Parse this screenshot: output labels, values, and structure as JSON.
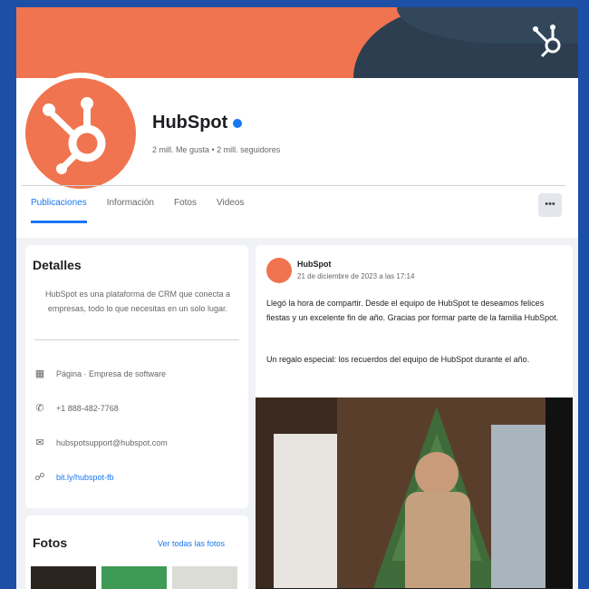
{
  "page": {
    "name": "HubSpot",
    "subtitle": "2 mill. Me gusta • 2 mill. seguidores"
  },
  "tabs": [
    {
      "label": "Publicaciones"
    },
    {
      "label": "Información"
    },
    {
      "label": "Fotos"
    },
    {
      "label": "Videos"
    }
  ],
  "more_button": "•••",
  "intro": {
    "title": "Detalles",
    "text": "HubSpot es una plataforma de CRM que conecta a empresas, todo lo que necesitas en un solo lugar.",
    "details": [
      {
        "icon": "page-icon",
        "text": "Página · Empresa de software"
      },
      {
        "icon": "phone-icon",
        "text": "+1 888-482-7768"
      },
      {
        "icon": "email-icon",
        "text": "hubspotsupport@hubspot.com"
      },
      {
        "icon": "link-icon",
        "text": "bit.ly/hubspot-fb"
      }
    ]
  },
  "photos": {
    "title": "Fotos",
    "link": "Ver todas las fotos"
  },
  "post": {
    "author": "HubSpot",
    "date": "21 de diciembre de 2023 a las 17:14",
    "text1": "Llegó la hora de compartir. Desde el equipo de HubSpot te deseamos felices fiestas y un excelente fin de año. Gracias por formar parte de la familia HubSpot.",
    "text2": "Un regalo especial: los recuerdos del equipo de HubSpot durante el año."
  },
  "colors": {
    "brand_orange": "#f0744f",
    "navy": "#2d3e50",
    "facebook_blue": "#1877f2"
  }
}
